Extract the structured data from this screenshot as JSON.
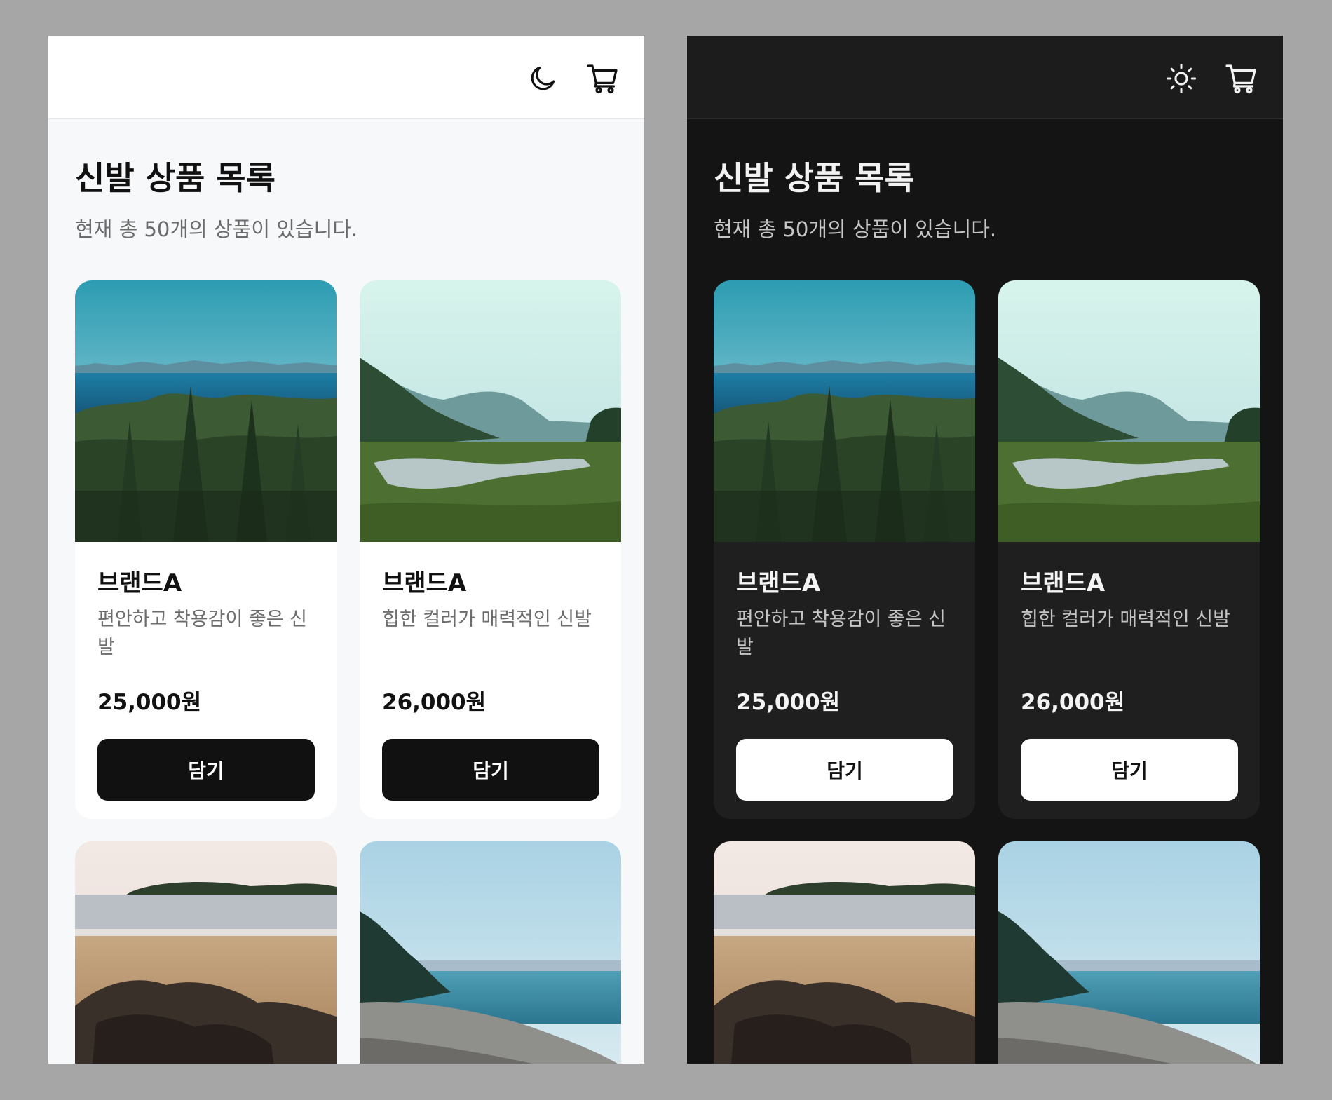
{
  "page": {
    "title": "신발 상품 목록",
    "subtitle": "현재 총 50개의 상품이 있습니다."
  },
  "themes": {
    "light": {
      "background": "#f7f8fa",
      "header": "#ffffff",
      "card": "#ffffff",
      "button": "#111111",
      "button_text": "#ffffff",
      "toggle_icon": "moon-icon"
    },
    "dark": {
      "background": "#141414",
      "header": "#1c1c1c",
      "card": "#1f1f1f",
      "button": "#ffffff",
      "button_text": "#111111",
      "toggle_icon": "sun-icon"
    }
  },
  "header": {
    "cart_icon": "cart-icon"
  },
  "products": [
    {
      "brand": "브랜드A",
      "description": "편안하고 착용감이 좋은 신발",
      "price": "25,000원",
      "button_label": "담기",
      "image": "forest-lake-photo"
    },
    {
      "brand": "브랜드A",
      "description": "힙한 컬러가 매력적인 신발",
      "price": "26,000원",
      "button_label": "담기",
      "image": "river-valley-photo"
    },
    {
      "brand": "",
      "description": "",
      "price": "",
      "button_label": "",
      "image": "rocky-beach-photo"
    },
    {
      "brand": "",
      "description": "",
      "price": "",
      "button_label": "",
      "image": "pebble-shore-photo"
    }
  ]
}
